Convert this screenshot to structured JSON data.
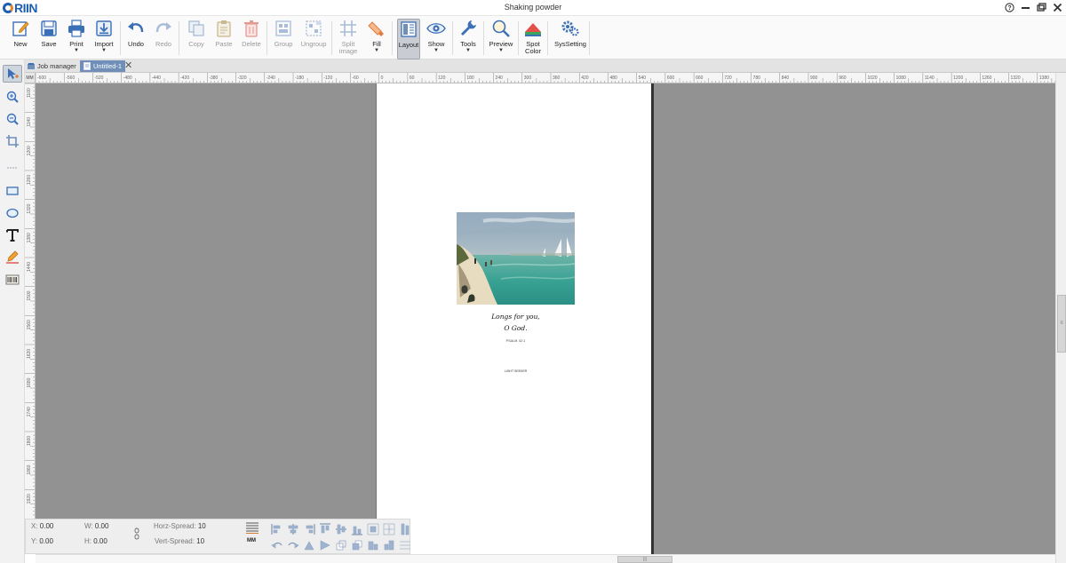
{
  "app": {
    "logo_text": "RIIN",
    "window_title": "Shaking powder"
  },
  "toolbar": {
    "new": "New",
    "save": "Save",
    "print": "Print",
    "import": "Import",
    "undo": "Undo",
    "redo": "Redo",
    "copy": "Copy",
    "paste": "Paste",
    "delete": "Delete",
    "group": "Group",
    "ungroup": "Ungroup",
    "split_image": "Split image",
    "fill": "Fill",
    "layout": "Layout",
    "show": "Show",
    "tools": "Tools",
    "preview": "Preview",
    "spot_color": "Spot Color",
    "syssetting": "SysSetting"
  },
  "tabs": [
    {
      "label": "Job manager"
    },
    {
      "label": "Untitled-1"
    }
  ],
  "ruler": {
    "unit": "MM",
    "h_ticks": [
      "-600",
      "-560",
      "-520",
      "-480",
      "-440",
      "-420",
      "-380",
      "-320",
      "-240",
      "-180",
      "-120",
      "-60",
      "0",
      "60",
      "120",
      "180",
      "240",
      "300",
      "360",
      "420",
      "480",
      "540",
      "600",
      "660",
      "720",
      "780",
      "840",
      "900",
      "960",
      "1020",
      "1080",
      "1140",
      "1200",
      "1260",
      "1320",
      "1380"
    ],
    "v_ticks": [
      "1100",
      "1140",
      "1200",
      "1260",
      "1320",
      "1380",
      "1440",
      "1500",
      "1560",
      "1620",
      "1680",
      "1740",
      "1800",
      "1860",
      "1920"
    ]
  },
  "document": {
    "line1": "Longs for you,",
    "line2": "O God.",
    "psalm": "PSALM 42:1",
    "footer": "LIGHT SEEKER"
  },
  "info": {
    "x_label": "X:",
    "x_value": "0.00",
    "y_label": "Y:",
    "y_value": "0.00",
    "w_label": "W:",
    "w_value": "0.00",
    "h_label": "H:",
    "h_value": "0.00",
    "horz_label": "Horz-Spread:",
    "horz_value": "10",
    "vert_label": "Vert-Spread:",
    "vert_value": "10",
    "mm_label": "MM"
  }
}
